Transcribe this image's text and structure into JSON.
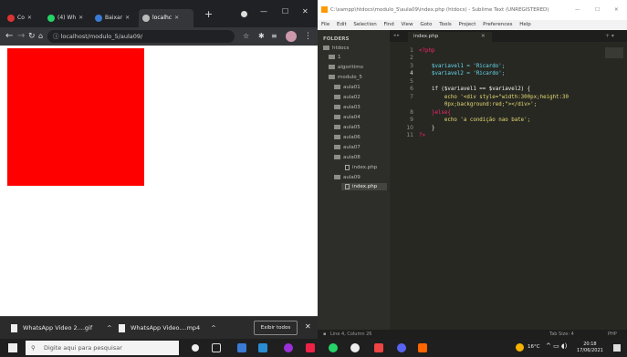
{
  "browser": {
    "tabs": [
      {
        "label": "Co",
        "fav_color": "#d33"
      },
      {
        "label": "(4) Wh",
        "fav_color": "#25d366"
      },
      {
        "label": "Baixar",
        "fav_color": "#3a7bd5"
      },
      {
        "label": "localhc",
        "fav_color": "#bbb"
      }
    ],
    "new_tab": "+",
    "url": "localhost/modulo_5/aula09/",
    "page_box_color": "#ff0000"
  },
  "downloads": {
    "items": [
      "WhatsApp Video 2....gif",
      "WhatsApp Video....mp4"
    ],
    "show_all": "Exibir todos"
  },
  "sublime": {
    "title": "C:\\xampp\\htdocs\\modulo_5\\aula09\\index.php (htdocs) - Sublime Text (UNREGISTERED)",
    "menu": [
      "File",
      "Edit",
      "Selection",
      "Find",
      "View",
      "Goto",
      "Tools",
      "Project",
      "Preferences",
      "Help"
    ],
    "sidebar_header": "FOLDERS",
    "tree": [
      "htdocs",
      "1",
      "algoritimo",
      "modulo_5",
      "aula01",
      "aula02",
      "aula03",
      "aula04",
      "aula05",
      "aula06",
      "aula07",
      "aula08",
      "index.php",
      "aula09",
      "index.php"
    ],
    "tab_label": "index.php",
    "lines": [
      {
        "n": "1",
        "t": "<?php",
        "c": "plain"
      },
      {
        "n": "2",
        "t": "",
        "c": "plain"
      },
      {
        "n": "3",
        "t": "    $variavel1 = 'Ricardo';",
        "c": "var"
      },
      {
        "n": "4",
        "t": "    $variavel2 = 'Ricardo';",
        "c": "var"
      },
      {
        "n": "5",
        "t": "",
        "c": "plain"
      },
      {
        "n": "6",
        "t": "    if ($variavel1 == $variavel2) {",
        "c": "plain"
      },
      {
        "n": "7",
        "t": "        echo '<div style=\"width:300px;height:30",
        "c": "str"
      },
      {
        "n": "",
        "t": "        0px;background:red;\"></div>';",
        "c": "str"
      },
      {
        "n": "8",
        "t": "    }else{",
        "c": "kw"
      },
      {
        "n": "9",
        "t": "        echo 'a condição nao bate';",
        "c": "str"
      },
      {
        "n": "10",
        "t": "    }",
        "c": "plain"
      },
      {
        "n": "11",
        "t": "?>",
        "c": "plain"
      }
    ],
    "status_left": "Line 4, Column 26",
    "status_tab": "Tab Size: 4",
    "status_lang": "PHP"
  },
  "taskbar": {
    "search_placeholder": "Digite aqui para pesquisar",
    "weather": "16°C",
    "time": "20:18",
    "date": "17/06/2021"
  }
}
